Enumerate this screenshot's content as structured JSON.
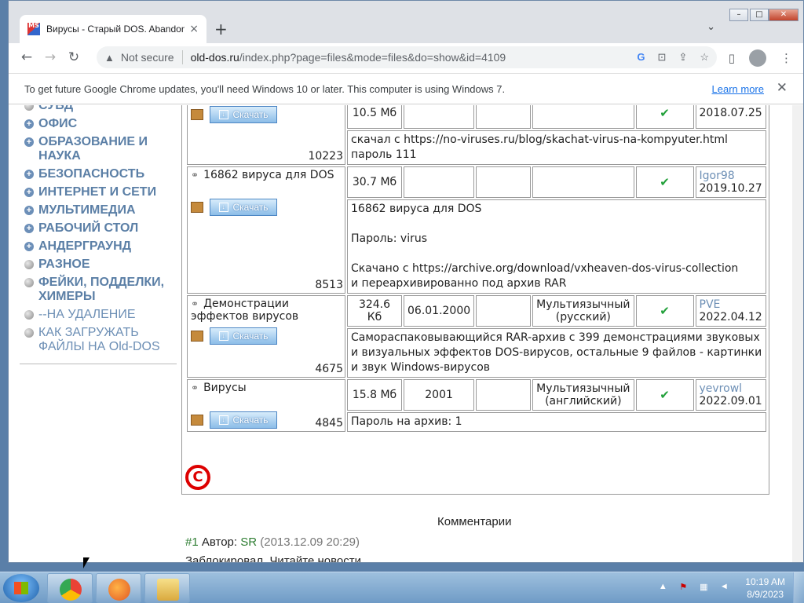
{
  "window": {
    "tab_title": "Вирусы - Старый DOS. Abandon",
    "tab_close": "×",
    "new_tab": "+",
    "tab_search": "⌄",
    "min": "–",
    "max": "□",
    "close": "✕"
  },
  "toolbar": {
    "back": "←",
    "forward": "→",
    "reload": "↻",
    "warn_icon": "▲",
    "not_secure": "Not secure",
    "url_host": "old-dos.ru",
    "url_path": "/index.php?page=files&mode=files&do=show&id=4109",
    "google": "G",
    "translate": "⊡",
    "share": "⇪",
    "star": "☆",
    "sidepanel": "▯",
    "menu": "⋮"
  },
  "infobar": {
    "text": "To get future Google Chrome updates, you'll need Windows 10 or later. This computer is using Windows 7.",
    "learn_more": "Learn more",
    "close": "✕"
  },
  "sidebar": {
    "items": [
      {
        "label": "СУБД",
        "bullet": "grey"
      },
      {
        "label": "ОФИС",
        "bullet": "blue"
      },
      {
        "label": "ОБРАЗОВАНИЕ И НАУКА",
        "bullet": "blue"
      },
      {
        "label": "БЕЗОПАСНОСТЬ",
        "bullet": "blue"
      },
      {
        "label": "ИНТЕРНЕТ И СЕТИ",
        "bullet": "blue"
      },
      {
        "label": "МУЛЬТИМЕДИА",
        "bullet": "blue"
      },
      {
        "label": "РАБОЧИЙ СТОЛ",
        "bullet": "blue"
      },
      {
        "label": "АНДЕРГРАУНД",
        "bullet": "blue"
      },
      {
        "label": "РАЗНОЕ",
        "bullet": "grey"
      },
      {
        "label": "ФЕЙКИ, ПОДДЕЛКИ, ХИМЕРЫ",
        "bullet": "grey"
      },
      {
        "label": "--НА УДАЛЕНИЕ",
        "bullet": "grey",
        "light": true
      },
      {
        "label": "КАК ЗАГРУЖАТЬ ФАЙЛЫ НА Old-DOS",
        "bullet": "grey",
        "light": true
      }
    ]
  },
  "download_label": "Скачать",
  "files": [
    {
      "title": "",
      "count": "10223",
      "size": "10.5 Мб",
      "year": "",
      "col3": "",
      "lang": "",
      "author": "",
      "date": "2018.07.25",
      "desc": "скачал с https://no-viruses.ru/blog/skachat-virus-na-kompyuter.html\nпароль 111"
    },
    {
      "title": "16862 вируса для DOS",
      "count": "8513",
      "size": "30.7 Мб",
      "year": "",
      "col3": "",
      "lang": "",
      "author": "Igor98",
      "date": "2019.10.27",
      "desc": "16862 вируса для DOS\n\nПароль: virus\n\nСкачано с https://archive.org/download/vxheaven-dos-virus-collection\nи переархивированно под архив RAR"
    },
    {
      "title": "Демонстрации эффектов вирусов",
      "count": "4675",
      "size": "324.6 Кб",
      "year": "06.01.2000",
      "col3": "",
      "lang": "Мультиязычный (русский)",
      "author": "PVE",
      "date": "2022.04.12",
      "desc": "Самораспаковывающийся RAR-архив с 399 демонстрациями звуковых\nи визуальных эффектов DOS-вирусов, остальные 9 файлов - картинки\nи звук Windows-вирусов"
    },
    {
      "title": "Вирусы",
      "count": "4845",
      "size": "15.8 Мб",
      "year": "2001",
      "col3": "",
      "lang": "Мультиязычный (английский)",
      "author": "yevrowl",
      "date": "2022.09.01",
      "desc": "Пароль на архив: 1"
    }
  ],
  "copyright_symbol": "C",
  "comments": {
    "heading": "Комментарии",
    "c1_num": "#1",
    "c1_label": "Автор:",
    "c1_author": "SR",
    "c1_meta": "(2013.12.09 20:29)",
    "c1_text": "Заблокировал. Читайте новости"
  },
  "taskbar": {
    "time": "10:19 AM",
    "date": "8/9/2023",
    "tray_arrow": "▲"
  }
}
